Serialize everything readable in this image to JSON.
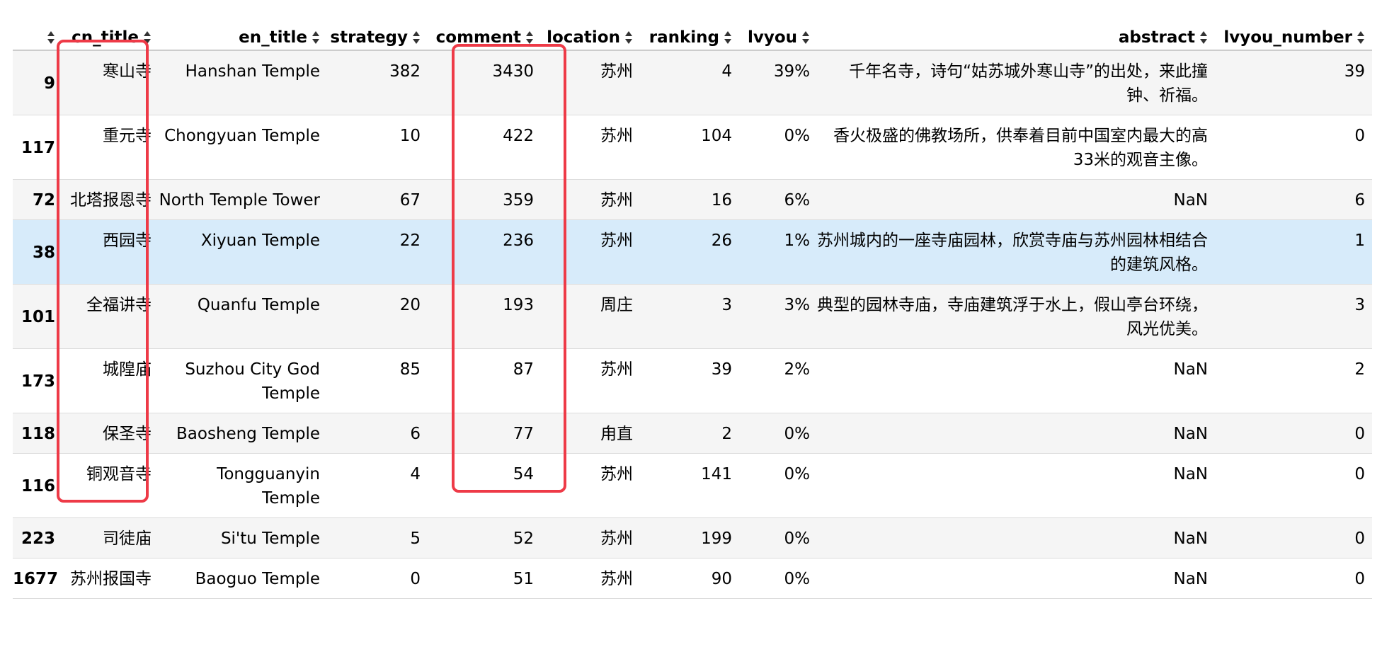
{
  "columns": [
    "",
    "cn_title",
    "en_title",
    "strategy",
    "comment",
    "location",
    "ranking",
    "lvyou",
    "abstract",
    "lvyou_number"
  ],
  "rows": [
    {
      "idx": "9",
      "cn_title": "寒山寺",
      "en_title": "Hanshan Temple",
      "strategy": "382",
      "comment": "3430",
      "location": "苏州",
      "ranking": "4",
      "lvyou": "39%",
      "abstract": "千年名寺，诗句“姑苏城外寒山寺”的出处，来此撞钟、祈福。",
      "lvyou_number": "39"
    },
    {
      "idx": "117",
      "cn_title": "重元寺",
      "en_title": "Chongyuan Temple",
      "strategy": "10",
      "comment": "422",
      "location": "苏州",
      "ranking": "104",
      "lvyou": "0%",
      "abstract": "香火极盛的佛教场所，供奉着目前中国室内最大的高33米的观音主像。",
      "lvyou_number": "0"
    },
    {
      "idx": "72",
      "cn_title": "北塔报恩寺",
      "en_title": "North Temple Tower",
      "strategy": "67",
      "comment": "359",
      "location": "苏州",
      "ranking": "16",
      "lvyou": "6%",
      "abstract": "NaN",
      "lvyou_number": "6"
    },
    {
      "idx": "38",
      "cn_title": "西园寺",
      "en_title": "Xiyuan Temple",
      "strategy": "22",
      "comment": "236",
      "location": "苏州",
      "ranking": "26",
      "lvyou": "1%",
      "abstract": "苏州城内的一座寺庙园林，欣赏寺庙与苏州园林相结合的建筑风格。",
      "lvyou_number": "1"
    },
    {
      "idx": "101",
      "cn_title": "全福讲寺",
      "en_title": "Quanfu Temple",
      "strategy": "20",
      "comment": "193",
      "location": "周庄",
      "ranking": "3",
      "lvyou": "3%",
      "abstract": "典型的园林寺庙，寺庙建筑浮于水上，假山亭台环绕，风光优美。",
      "lvyou_number": "3"
    },
    {
      "idx": "173",
      "cn_title": "城隍庙",
      "en_title": "Suzhou City God Temple",
      "strategy": "85",
      "comment": "87",
      "location": "苏州",
      "ranking": "39",
      "lvyou": "2%",
      "abstract": "NaN",
      "lvyou_number": "2"
    },
    {
      "idx": "118",
      "cn_title": "保圣寺",
      "en_title": "Baosheng Temple",
      "strategy": "6",
      "comment": "77",
      "location": "甪直",
      "ranking": "2",
      "lvyou": "0%",
      "abstract": "NaN",
      "lvyou_number": "0"
    },
    {
      "idx": "116",
      "cn_title": "铜观音寺",
      "en_title": "Tongguanyin Temple",
      "strategy": "4",
      "comment": "54",
      "location": "苏州",
      "ranking": "141",
      "lvyou": "0%",
      "abstract": "NaN",
      "lvyou_number": "0"
    },
    {
      "idx": "223",
      "cn_title": "司徒庙",
      "en_title": "Si'tu Temple",
      "strategy": "5",
      "comment": "52",
      "location": "苏州",
      "ranking": "199",
      "lvyou": "0%",
      "abstract": "NaN",
      "lvyou_number": "0"
    },
    {
      "idx": "1677",
      "cn_title": "苏州报国寺",
      "en_title": "Baoguo Temple",
      "strategy": "0",
      "comment": "51",
      "location": "苏州",
      "ranking": "90",
      "lvyou": "0%",
      "abstract": "NaN",
      "lvyou_number": "0"
    }
  ],
  "highlight_row_index": 3,
  "colors": {
    "annotation_box": "#ee3a47",
    "row_stripe": "#f5f5f5",
    "row_highlight": "#d7ebfa"
  },
  "annotations": [
    {
      "name": "cn-title-highlight-box",
      "column": "cn_title"
    },
    {
      "name": "comment-highlight-box",
      "column": "comment"
    }
  ]
}
